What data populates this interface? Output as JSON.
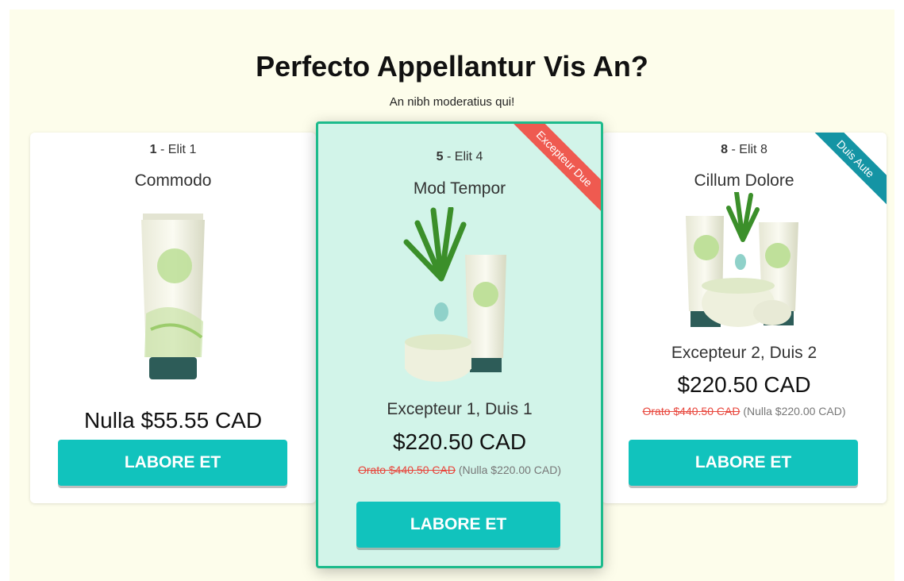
{
  "header": {
    "title": "Perfecto Appellantur Vis An?",
    "subtitle": "An nibh moderatius qui!"
  },
  "cards": [
    {
      "elit_number": "1",
      "elit_label": " - Elit 1",
      "name": "Commodo",
      "price": "Nulla $55.55 CAD",
      "button": "LABORE ET"
    },
    {
      "elit_number": "5",
      "elit_label": " - Elit 4",
      "name": "Mod Tempor",
      "summary": "Excepteur 1, Duis 1",
      "price": "$220.50 CAD",
      "compare_strike": "Orato $440.50 CAD",
      "compare_note": " (Nulla $220.00 CAD)",
      "button": "LABORE ET",
      "ribbon": "Excepteur Due",
      "ribbon_color": "#ef5a50",
      "highlight_color": "#1dbb8c"
    },
    {
      "elit_number": "8",
      "elit_label": " - Elit 8",
      "name": "Cillum Dolore",
      "summary": "Excepteur 2, Duis 2",
      "price": "$220.50 CAD",
      "compare_strike": "Orato $440.50 CAD",
      "compare_note": " (Nulla $220.00 CAD)",
      "button": "LABORE ET",
      "ribbon": "Duis Aute",
      "ribbon_color": "#1494a4"
    }
  ],
  "colors": {
    "button": "#11c3bd",
    "section_bg": "#fdfdeb",
    "strike": "#e8463c"
  }
}
